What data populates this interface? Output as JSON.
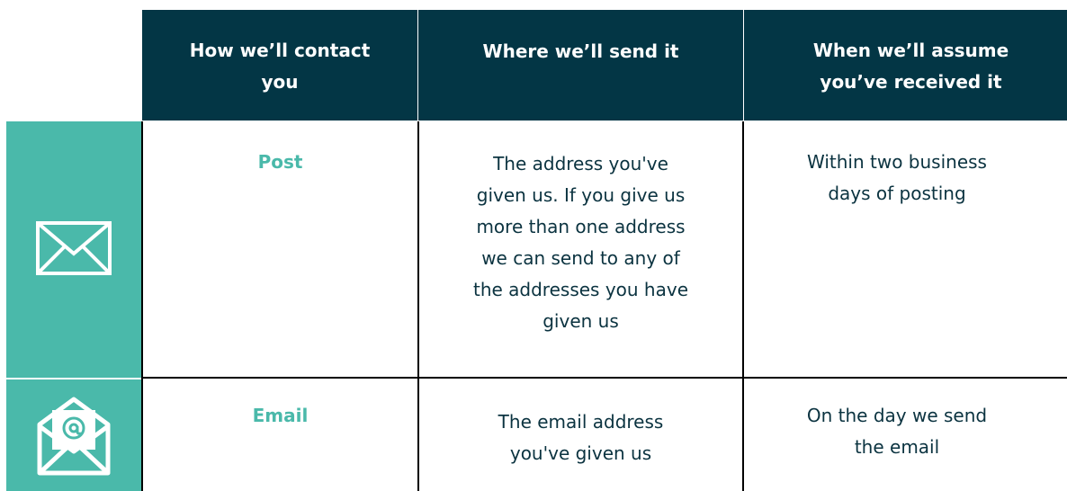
{
  "header": {
    "col1_line1": "How we’ll contact",
    "col1_line2": "you",
    "col2": "Where we’ll send it",
    "col3_line1": "When we’ll assume",
    "col3_line2": "you’ve received it"
  },
  "rows": [
    {
      "icon": "envelope-icon",
      "method": "Post",
      "where_lines": [
        "The address you've",
        "given us. If you give us",
        "more than one address",
        "we can send to any of",
        "the addresses you have",
        "given us"
      ],
      "when_lines": [
        "Within two business",
        "days of posting"
      ]
    },
    {
      "icon": "email-at-envelope-icon",
      "method": "Email",
      "where_lines": [
        "The email address",
        "you've given us"
      ],
      "when_lines": [
        "On the day we send",
        "the email"
      ]
    }
  ],
  "colors": {
    "header_bg": "#033645",
    "accent": "#4ab9aa",
    "text": "#0b3340"
  }
}
